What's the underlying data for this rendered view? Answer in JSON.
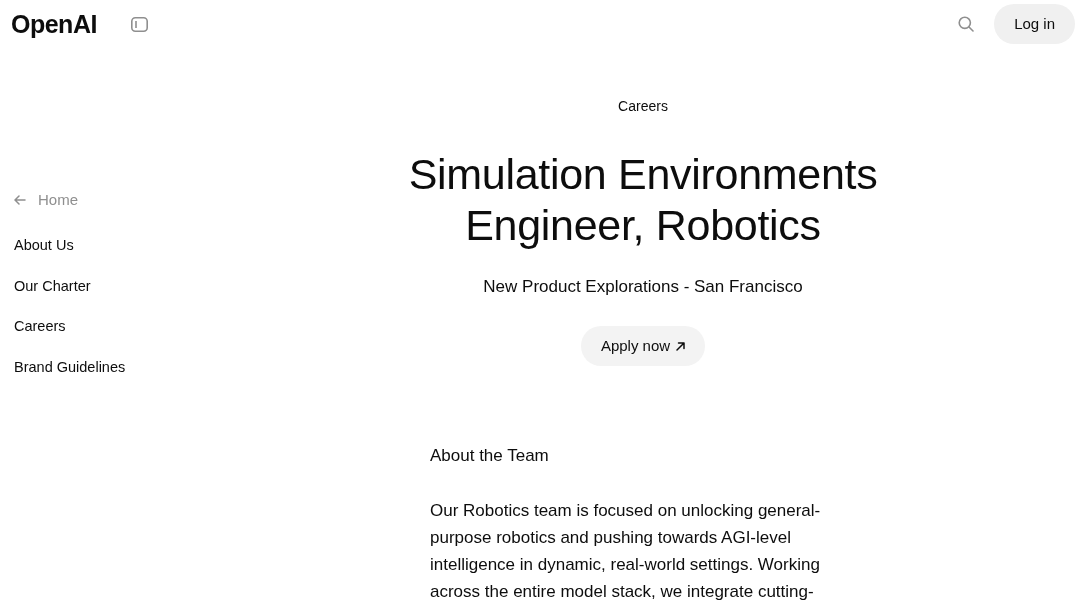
{
  "header": {
    "logo": "OpenAI",
    "login_button": "Log in"
  },
  "sidebar": {
    "back_link": "Home",
    "items": [
      {
        "label": "About Us"
      },
      {
        "label": "Our Charter"
      },
      {
        "label": "Careers"
      },
      {
        "label": "Brand Guidelines"
      }
    ]
  },
  "main": {
    "eyebrow": "Careers",
    "title": "Simulation Environments Engineer, Robotics",
    "subtitle": "New Product Explorations - San Francisco",
    "apply_button": "Apply now",
    "section_heading": "About the Team",
    "paragraph": "Our Robotics team is focused on unlocking general-purpose robotics and pushing towards AGI-level intelligence in dynamic, real-world settings. Working across the entire model stack, we integrate cutting-"
  }
}
